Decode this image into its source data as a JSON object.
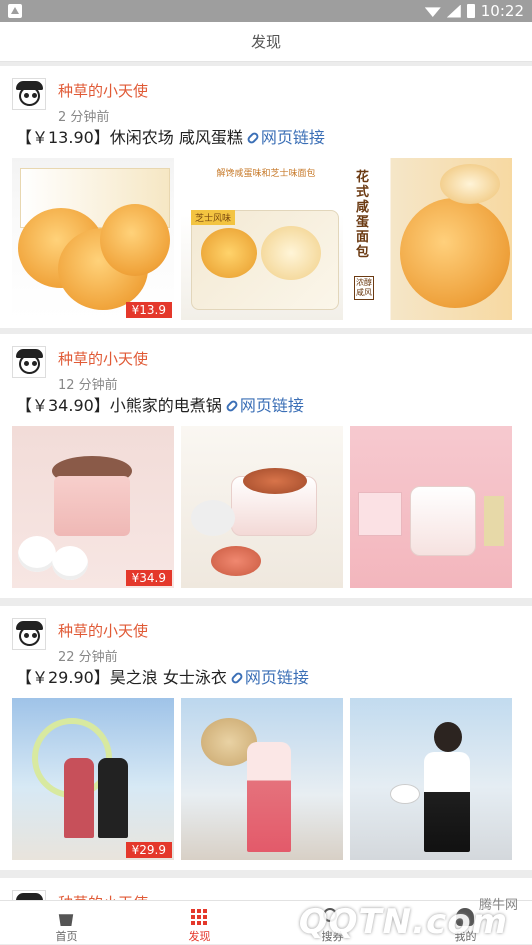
{
  "status_bar": {
    "time": "10:22"
  },
  "header": {
    "title": "发现"
  },
  "posts": [
    {
      "author": "种草的小天使",
      "time": "2 分钟前",
      "title_prefix": "【￥13.90】休闲农场  咸风蛋糕",
      "link_text": "网页链接",
      "price_tag": "¥13.9"
    },
    {
      "author": "种草的小天使",
      "time": "12 分钟前",
      "title_prefix": "【￥34.90】小熊家的电煮锅",
      "link_text": "网页链接",
      "price_tag": "¥34.9"
    },
    {
      "author": "种草的小天使",
      "time": "22 分钟前",
      "title_prefix": "【￥29.90】昊之浪  女士泳衣",
      "link_text": "网页链接",
      "price_tag": "¥29.9"
    },
    {
      "author": "种草的小天使"
    }
  ],
  "image_text": {
    "bread_b_top": "解馋咸蛋味和芝士味面包",
    "bread_b_badge": "芝士风味",
    "bread_c_big": "花式咸蛋面包",
    "bread_c_small": "浓醇咸风"
  },
  "tabs": [
    {
      "label": "首页",
      "icon": "cart-icon"
    },
    {
      "label": "发现",
      "icon": "grid-icon",
      "active": true
    },
    {
      "label": "搜券",
      "icon": "search-icon"
    },
    {
      "label": "我的",
      "icon": "person-icon"
    }
  ],
  "watermark": {
    "small": "腾牛网",
    "main": "QQTN.com"
  },
  "colors": {
    "accent": "#e4382b",
    "author": "#e05a36",
    "link": "#3b6fb6"
  }
}
